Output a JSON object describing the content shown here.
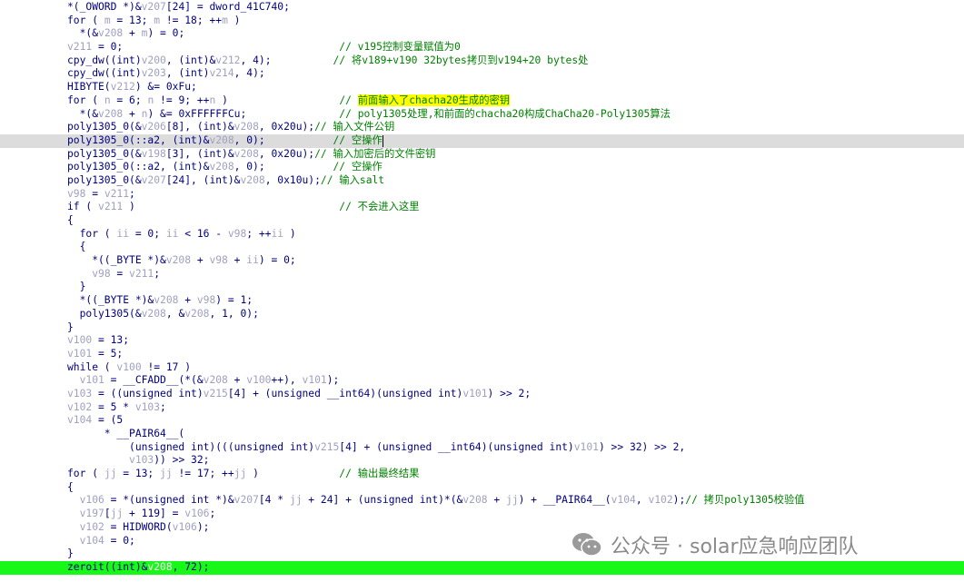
{
  "watermark": {
    "text": "公众号 · solar应急响应团队",
    "icon": "wechat-icon"
  },
  "code_lines": [
    "*(_OWORD *)&v207[24] = dword_41C740;",
    "for ( m = 13; m != 18; ++m )",
    "  *(&v208 + m) = 0;",
    "v211 = 0;                                   // v195控制变量赋值为0",
    "cpy_dw((int)v200, (int)&v212, 4);          // 将v189+v190 32bytes拷贝到v194+20 bytes处",
    "cpy_dw((int)v203, (int)v214, 4);",
    "HIBYTE(v212) &= 0xFu;",
    "for ( n = 6; n != 9; ++n )                  // 前面输入了chacha20生成的密钥",
    "  *(&v208 + n) &= 0xFFFFFFCu;               // poly1305处理,和前面的chacha20构成ChaCha20-Poly1305算法",
    "poly1305_0(&v206[8], (int)&v208, 0x20u);// 输入文件公钥",
    "poly1305_0(::a2, (int)&v208, 0);           // 空操作",
    "poly1305_0(&v198[3], (int)&v208, 0x20u);// 输入加密后的文件密钥",
    "poly1305_0(::a2, (int)&v208, 0);           // 空操作",
    "poly1305_0(&v207[24], (int)&v208, 0x10u);// 输入salt",
    "v98 = v211;",
    "if ( v211 )                                 // 不会进入这里",
    "{",
    "  for ( ii = 0; ii < 16 - v98; ++ii )",
    "  {",
    "    *((_BYTE *)&v208 + v98 + ii) = 0;",
    "    v98 = v211;",
    "  }",
    "  *((_BYTE *)&v208 + v98) = 1;",
    "  poly1305(&v208, &v208, 1, 0);",
    "}",
    "v100 = 13;",
    "v101 = 5;",
    "while ( v100 != 17 )",
    "  v101 = __CFADD__(*(&v208 + v100++), v101);",
    "v103 = ((unsigned int)v215[4] + (unsigned __int64)(unsigned int)v101) >> 2;",
    "v102 = 5 * v103;",
    "v104 = (5",
    "      * __PAIR64__(",
    "          (unsigned int)(((unsigned int)v215[4] + (unsigned __int64)(unsigned int)v101) >> 32) >> 2,",
    "          v103)) >> 32;",
    "for ( jj = 13; jj != 17; ++jj )             // 输出最终结果",
    "{",
    "  v106 = *(unsigned int *)&v207[4 * jj + 24] + (unsigned int)*(&v208 + jj) + __PAIR64__(v104, v102);// 拷贝poly1305校验值",
    "  v197[jj + 119] = v106;",
    "  v102 = HIDWORD(v106);",
    "  v104 = 0;",
    "}",
    "zeroit((int)&v208, 72);"
  ]
}
